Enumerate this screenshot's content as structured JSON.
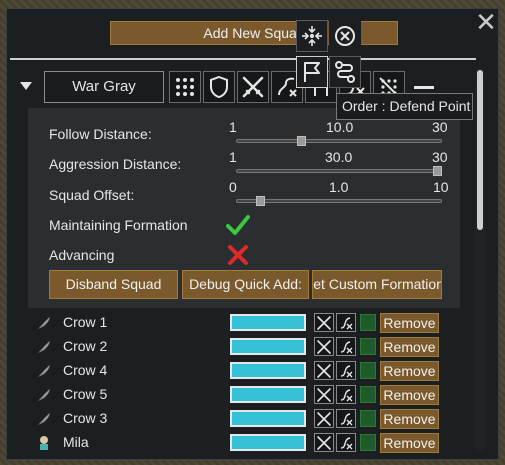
{
  "header": {
    "add_squad_label": "Add New Squad",
    "close_glyph": "✕"
  },
  "squad": {
    "name": "War Gray",
    "formation_icons": [
      "grid-dots-icon",
      "shield-icon",
      "crossed-swords-icon",
      "path-x-icon",
      "defend-point-icon",
      "route-icon",
      "crossed-out-grid-icon"
    ]
  },
  "settings": {
    "follow_distance": {
      "label": "Follow Distance:",
      "min": "1",
      "value": "10.0",
      "max": "30",
      "fraction": 0.31
    },
    "aggression_distance": {
      "label": "Aggression Distance:",
      "min": "1",
      "value": "30.0",
      "max": "30",
      "fraction": 1.0
    },
    "squad_offset": {
      "label": "Squad Offset:",
      "min": "0",
      "value": "1.0",
      "max": "10",
      "fraction": 0.1
    },
    "maintaining_formation": {
      "label": "Maintaining Formation",
      "state": true
    },
    "advancing": {
      "label": "Advancing",
      "state": false
    },
    "buttons": {
      "disband": "Disband Squad",
      "debug_add": "Debug Quick Add:",
      "custom_formation": "Set Custom Formation"
    }
  },
  "members": [
    {
      "name": "Crow 1",
      "remove_label": "Remove",
      "icon": "feather-icon"
    },
    {
      "name": "Crow 2",
      "remove_label": "Remove",
      "icon": "feather-icon"
    },
    {
      "name": "Crow 4",
      "remove_label": "Remove",
      "icon": "feather-icon"
    },
    {
      "name": "Crow 5",
      "remove_label": "Remove",
      "icon": "feather-icon"
    },
    {
      "name": "Crow 3",
      "remove_label": "Remove",
      "icon": "feather-icon"
    },
    {
      "name": "Mila",
      "remove_label": "Remove",
      "icon": "pawn-portrait-icon"
    }
  ],
  "order_popup": {
    "icons": [
      "move-arrows-icon",
      "cancel-circle-icon",
      "flag-icon",
      "route-icon"
    ],
    "tooltip": "Order : Defend Point"
  },
  "colors": {
    "button_brown": "#7a5a2c",
    "hp_cyan": "#35c2d6",
    "check_green": "#3ec83e",
    "cross_red": "#e02a2a"
  }
}
